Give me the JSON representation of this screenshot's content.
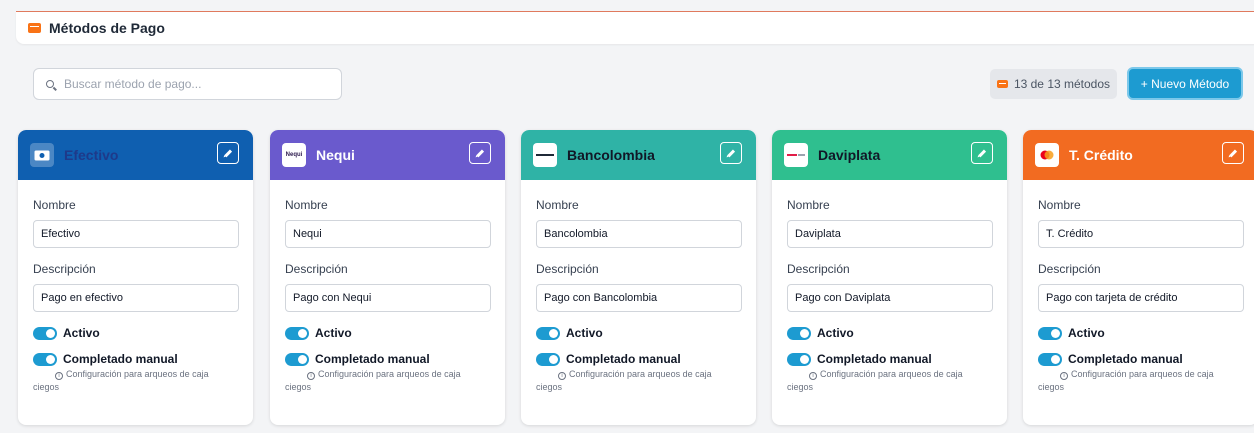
{
  "header": {
    "title": "Métodos de Pago",
    "icon": "wallet-icon",
    "accent": "#f97316"
  },
  "search": {
    "placeholder": "Buscar método de pago...",
    "value": ""
  },
  "counter": {
    "text": "13 de 13 métodos"
  },
  "new_button": {
    "label": "+ Nuevo Método"
  },
  "common": {
    "name_label": "Nombre",
    "description_label": "Descripción",
    "active_label": "Activo",
    "manual_label": "Completado manual",
    "help_text": "Configuración para arqueos de caja ciegos"
  },
  "methods": [
    {
      "title": "Efectivo",
      "name": "Efectivo",
      "description": "Pago en efectivo",
      "color": "#0f5fb0",
      "title_color": "#1e3a8a",
      "logo": "cash-icon",
      "active": true,
      "manual": true
    },
    {
      "title": "Nequi",
      "name": "Nequi",
      "description": "Pago con Nequi",
      "color": "#6a5acd",
      "title_color": "#ffffff",
      "logo": "nequi-logo",
      "logo_text": "Nequi",
      "active": true,
      "manual": true
    },
    {
      "title": "Bancolombia",
      "name": "Bancolombia",
      "description": "Pago con Bancolombia",
      "color": "#2fb3a6",
      "title_color": "#111827",
      "logo": "bancolombia-logo",
      "active": true,
      "manual": true
    },
    {
      "title": "Daviplata",
      "name": "Daviplata",
      "description": "Pago con Daviplata",
      "color": "#2fbf8f",
      "title_color": "#111827",
      "logo": "daviplata-logo",
      "active": true,
      "manual": true
    },
    {
      "title": "T. Crédito",
      "name": "T. Crédito",
      "description": "Pago con tarjeta de crédito",
      "color": "#f26b21",
      "title_color": "#ffffff",
      "logo": "credit-card-icon",
      "active": true,
      "manual": true
    }
  ]
}
